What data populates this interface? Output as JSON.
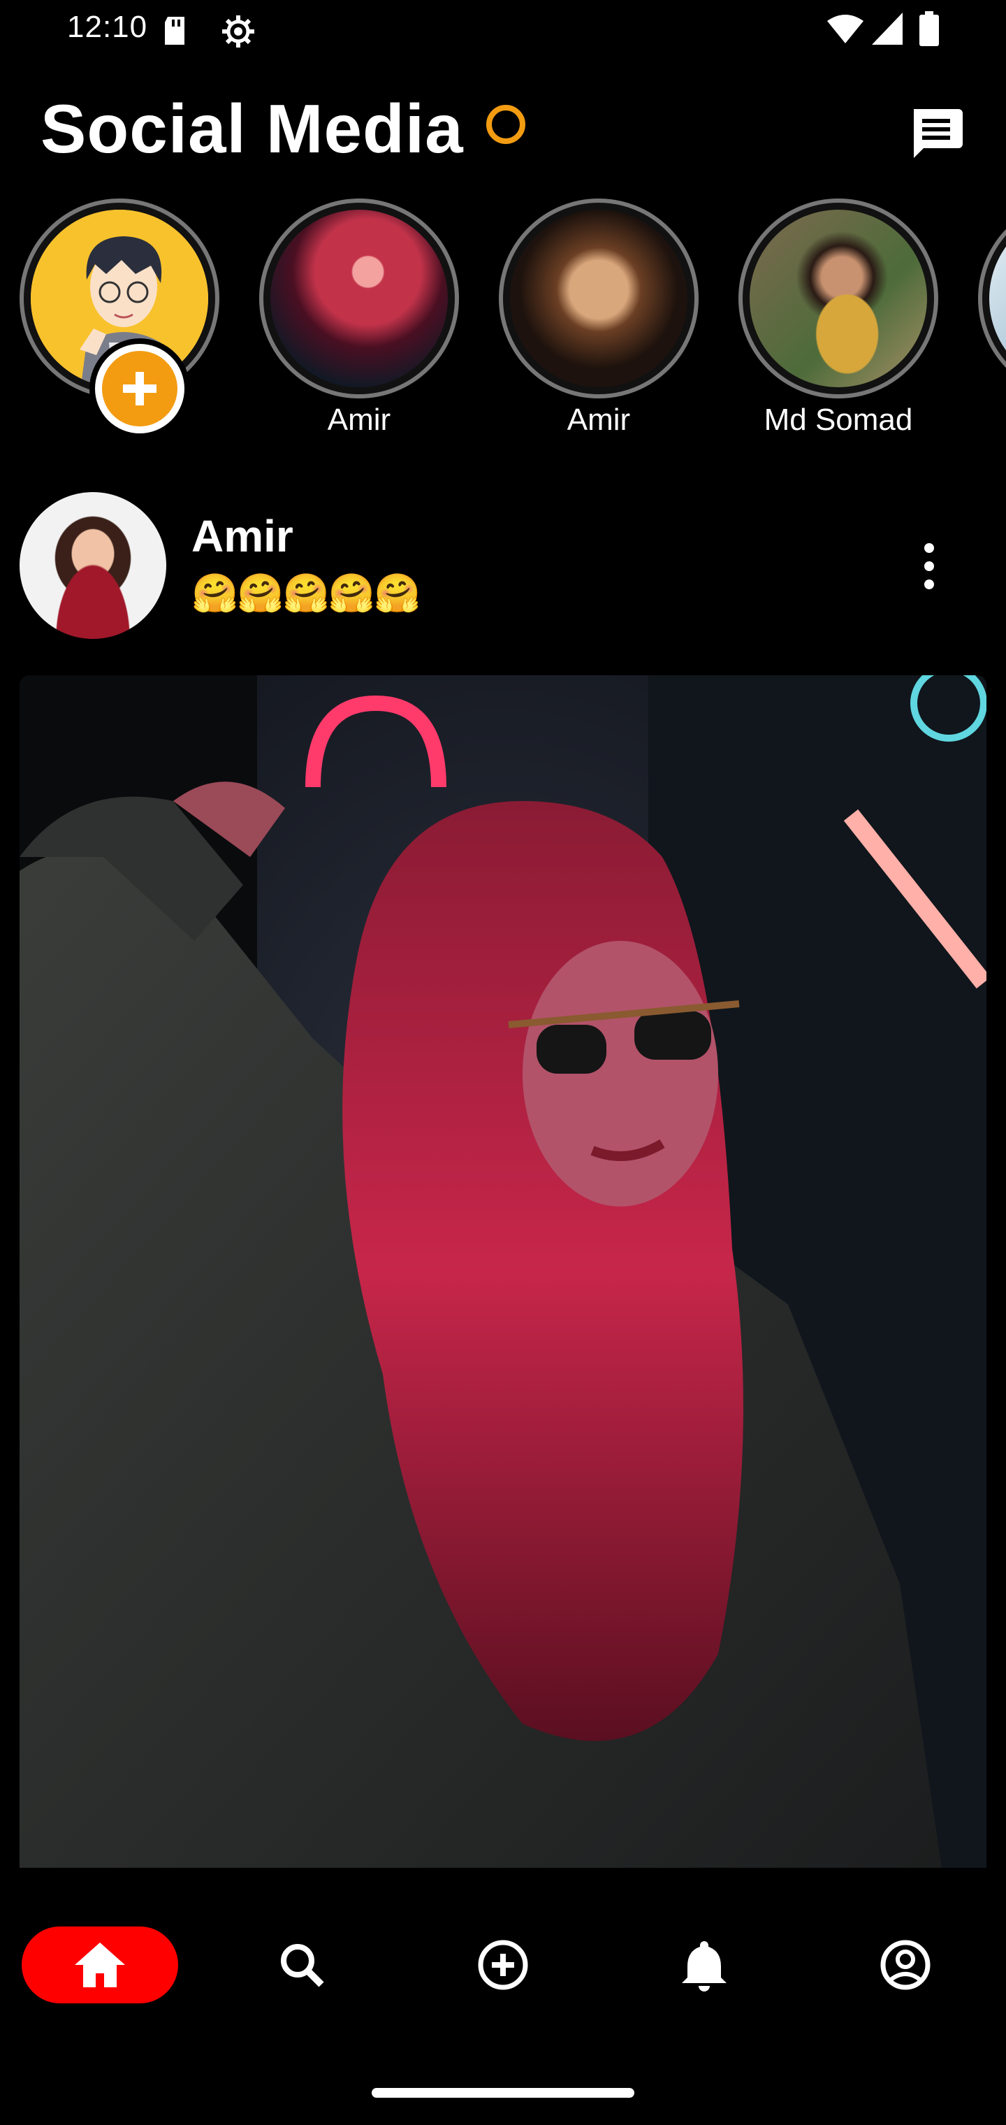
{
  "status_bar": {
    "time": "12:10"
  },
  "header": {
    "title": "Social Media",
    "accent_color": "#f39c12",
    "messages_icon": "message-icon"
  },
  "stories": [
    {
      "name": "",
      "type": "add-story"
    },
    {
      "name": "Amir"
    },
    {
      "name": "Amir"
    },
    {
      "name": "Md Somad"
    }
  ],
  "post": {
    "author": "Amir",
    "caption": "🤗🤗🤗🤗🤗",
    "menu_icon": "more-vert-icon"
  },
  "bottom_nav": {
    "items": [
      {
        "name": "home",
        "icon": "home-icon",
        "active": true
      },
      {
        "name": "search",
        "icon": "search-icon"
      },
      {
        "name": "add",
        "icon": "add-circle-icon"
      },
      {
        "name": "notifications",
        "icon": "bell-icon"
      },
      {
        "name": "profile",
        "icon": "account-circle-icon"
      }
    ],
    "active_color": "#ff0000"
  }
}
